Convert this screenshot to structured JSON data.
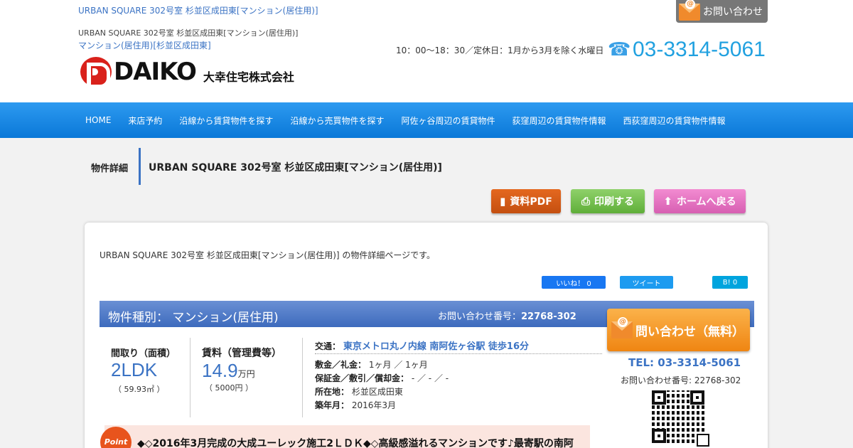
{
  "header": {
    "top_link": "URBAN SQUARE 302号室 杉並区成田東[マンション(居住用)]",
    "breadcrumb_line": "URBAN SQUARE 302号室 杉並区成田東[マンション(居住用)]",
    "breadcrumb_category": "マンション(居住用)[杉並区成田東]",
    "logo_name": "DAIKO",
    "logo_company": "大幸住宅株式会社",
    "contact_button": "お問い合わせ",
    "hours": "10：00～18：30／定休日：1月から3月を除く水曜日",
    "phone": "03-3314-5061"
  },
  "nav": {
    "items": [
      {
        "label": "HOME"
      },
      {
        "label": "来店予約"
      },
      {
        "label": "沿線から賃貸物件を探す"
      },
      {
        "label": "沿線から売買物件を探す"
      },
      {
        "label": "阿佐ヶ谷周辺の賃貸物件"
      },
      {
        "label": "荻窪周辺の賃貸物件情報"
      },
      {
        "label": "西荻窪周辺の賃貸物件情報"
      }
    ]
  },
  "page": {
    "label": "物件詳細",
    "title": "URBAN SQUARE 302号室 杉並区成田東[マンション(居住用)]",
    "buttons": {
      "pdf": "資料PDF",
      "print": "印刷する",
      "home": "ホームへ戻る"
    }
  },
  "card": {
    "intro": "URBAN SQUARE 302号室 杉並区成田東[マンション(居住用)] の物件詳細ページです。",
    "social": {
      "fb": "いいね！ 0",
      "tw": "ツイート",
      "hb": "B! 0"
    },
    "type_label": "物件種別： マンション(居住用)",
    "inquiry_label": "お問い合わせ番号：",
    "inquiry_no": "22768-302",
    "layout_label": "間取り（面積）",
    "layout_value": "2LDK",
    "area": "（ 59.93㎡ ）",
    "rent_label": "賃料（管理費等）",
    "rent_value": "14.9",
    "rent_unit": "万円",
    "mgmt_fee": "（ 5000円 ）",
    "access_label": "交通：",
    "access_value": "東京メトロ丸ノ内線 南阿佐ヶ谷駅 徒歩16分",
    "deposit_label": "敷金／礼金：",
    "deposit_value": "1ヶ月 ／ 1ヶ月",
    "guarantee_label": "保証金／敷引／償却金：",
    "guarantee_value": "- ／ - ／ -",
    "address_label": "所在地：",
    "address_value": "杉並区成田東",
    "built_label": "築年月：",
    "built_value": "2016年3月",
    "point_badge": "Point",
    "point_text": "◆◇2016年3月完成の大成ユーレック施工2ＬＤＫ◆◇高級感溢れるマンションです♪最寄駅の南阿"
  },
  "sidebar": {
    "cta": "問い合わせ（無料）",
    "tel": "TEL: 03-3314-5061",
    "inquiry": "お問い合わせ番号: 22768-302"
  },
  "colors": {
    "accent": "#3b73c4",
    "nav": "#0a78d8",
    "cta": "#ef8512"
  }
}
